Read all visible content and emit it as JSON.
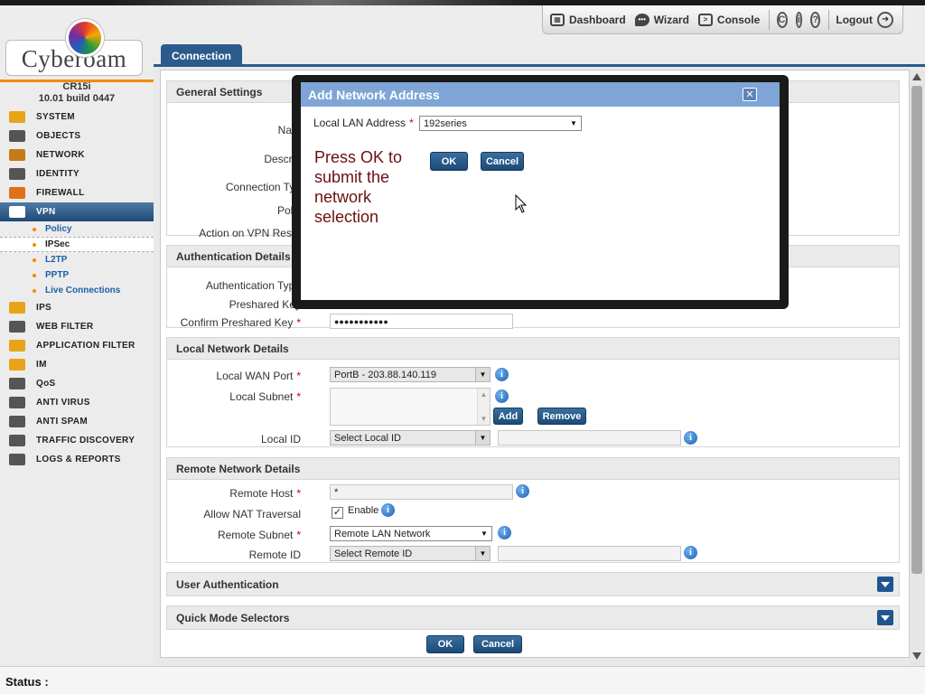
{
  "topnav": {
    "dashboard": "Dashboard",
    "wizard": "Wizard",
    "console": "Console",
    "logout": "Logout",
    "help_glyph": "?",
    "info_glyph": "i",
    "back_glyph": "C"
  },
  "brand": {
    "logo_text": "Cyberoam",
    "model": "CR15i",
    "build": "10.01 build 0447"
  },
  "menu": {
    "items": [
      {
        "label": "SYSTEM",
        "icon": "system-icon"
      },
      {
        "label": "OBJECTS",
        "icon": "objects-icon"
      },
      {
        "label": "NETWORK",
        "icon": "network-icon"
      },
      {
        "label": "IDENTITY",
        "icon": "identity-icon"
      },
      {
        "label": "FIREWALL",
        "icon": "firewall-icon"
      },
      {
        "label": "VPN",
        "icon": "vpn-icon",
        "active": true
      },
      {
        "label": "IPS",
        "icon": "ips-icon"
      },
      {
        "label": "WEB FILTER",
        "icon": "web-filter-icon"
      },
      {
        "label": "APPLICATION FILTER",
        "icon": "application-filter-icon"
      },
      {
        "label": "IM",
        "icon": "im-icon"
      },
      {
        "label": "QoS",
        "icon": "qos-icon"
      },
      {
        "label": "ANTI VIRUS",
        "icon": "anti-virus-icon"
      },
      {
        "label": "ANTI SPAM",
        "icon": "anti-spam-icon"
      },
      {
        "label": "TRAFFIC DISCOVERY",
        "icon": "traffic-discovery-icon"
      },
      {
        "label": "LOGS & REPORTS",
        "icon": "logs-reports-icon"
      }
    ],
    "vpn_sub": [
      "Policy",
      "IPSec",
      "L2TP",
      "PPTP",
      "Live Connections"
    ]
  },
  "tab": {
    "label": "Connection"
  },
  "general": {
    "title": "General Settings",
    "name_label": "Nam",
    "description_label": "Descrip",
    "connection_type_label": "Connection Typ",
    "policy_label": "Polic",
    "action_label": "Action on VPN Resta"
  },
  "auth": {
    "title": "Authentication Details",
    "type_label": "Authentication Type",
    "preshared_label": "Preshared Key",
    "confirm_label": "Confirm Preshared Key",
    "confirm_value": "●●●●●●●●●●●"
  },
  "local": {
    "title": "Local Network Details",
    "wan_label": "Local WAN Port",
    "wan_value": "PortB - 203.88.140.119",
    "subnet_label": "Local Subnet",
    "add": "Add",
    "remove": "Remove",
    "id_label": "Local ID",
    "id_value": "Select Local ID"
  },
  "remote": {
    "title": "Remote Network Details",
    "host_label": "Remote Host",
    "host_value": "*",
    "nat_label": "Allow NAT Traversal",
    "nat_enable": "Enable",
    "subnet_label": "Remote Subnet",
    "subnet_value": "Remote LAN Network",
    "id_label": "Remote ID",
    "id_value": "Select Remote ID"
  },
  "user_auth": {
    "title": "User Authentication"
  },
  "quick_mode": {
    "title": "Quick Mode Selectors"
  },
  "footer": {
    "ok": "OK",
    "cancel": "Cancel"
  },
  "status": {
    "label": "Status :"
  },
  "modal": {
    "title": "Add Network Address",
    "close": "✕",
    "lan_label": "Local LAN Address",
    "lan_value": "192series",
    "ok": "OK",
    "cancel": "Cancel",
    "annotation": "Press OK to submit the network selection"
  },
  "colors": {
    "accent": "#2a5b8c",
    "modal_title": "#7ea5d6",
    "active_menu": "#1f4a78",
    "brand_orange": "#f28c00",
    "annotation": "#6b1010"
  }
}
